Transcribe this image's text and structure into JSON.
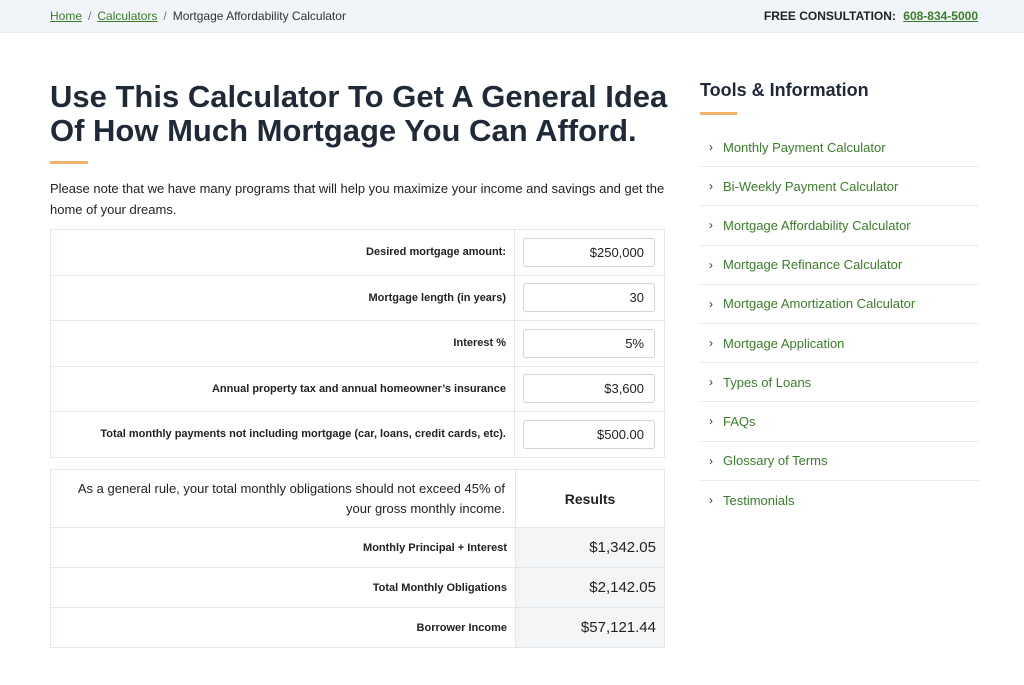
{
  "breadcrumb": {
    "home": "Home",
    "calculators": "Calculators",
    "current": "Mortgage Affordability Calculator"
  },
  "consultation": {
    "label": "FREE CONSULTATION:",
    "phone": "608-834-5000"
  },
  "main": {
    "heading": "Use This Calculator To Get A General Idea Of How Much Mortgage You Can Afford.",
    "intro": "Please note that we have many programs that will help you maximize your income and savings and get the home of your dreams."
  },
  "calculator": {
    "rows": [
      {
        "label": "Desired mortgage amount:",
        "value": "$250,000"
      },
      {
        "label": "Mortgage length (in years)",
        "value": "30"
      },
      {
        "label": "Interest %",
        "value": "5%"
      },
      {
        "label": "Annual property tax and annual homeowner’s insurance",
        "value": "$3,600"
      },
      {
        "label": "Total monthly payments not including mortgage (car, loans, credit cards, etc).",
        "value": "$500.00"
      }
    ]
  },
  "results": {
    "note": "As a general rule, your total monthly obligations should not exceed 45% of your gross monthly income.",
    "header": "Results",
    "rows": [
      {
        "label": "Monthly Principal + Interest",
        "value": "$1,342.05"
      },
      {
        "label": "Total Monthly Obligations",
        "value": "$2,142.05"
      },
      {
        "label": "Borrower Income",
        "value": "$57,121.44"
      }
    ]
  },
  "sidebar": {
    "title": "Tools & Information",
    "chevron": "›",
    "items": [
      {
        "label": "Monthly Payment Calculator"
      },
      {
        "label": "Bi-Weekly Payment Calculator"
      },
      {
        "label": "Mortgage Affordability Calculator"
      },
      {
        "label": "Mortgage Refinance Calculator"
      },
      {
        "label": "Mortgage Amortization Calculator"
      },
      {
        "label": "Mortgage Application"
      },
      {
        "label": "Types of Loans"
      },
      {
        "label": "FAQs"
      },
      {
        "label": "Glossary of Terms"
      },
      {
        "label": "Testimonials"
      }
    ]
  },
  "colors": {
    "link_green": "#3a7d2a",
    "accent_orange": "#f0b468",
    "topbar_bg": "#f1f4f8",
    "result_cell_bg": "#f3f5f7"
  },
  "icons": {
    "chevron": "chevron-right-icon"
  }
}
